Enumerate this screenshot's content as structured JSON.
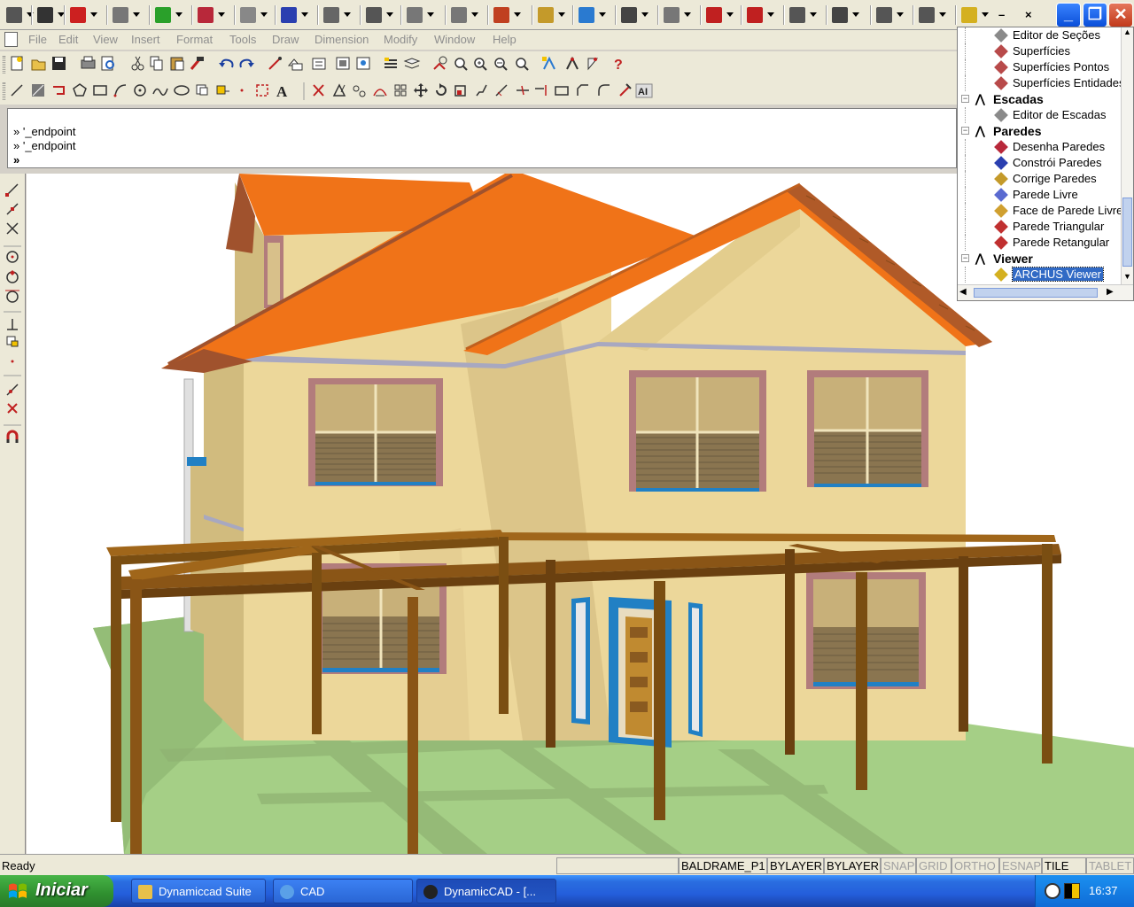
{
  "menu": [
    "File",
    "Edit",
    "View",
    "Insert",
    "Format",
    "Tools",
    "Draw",
    "Dimension",
    "Modify",
    "Window",
    "Help"
  ],
  "command": {
    "history": [
      "» '_endpoint",
      "» '_endpoint"
    ],
    "prompt": "»"
  },
  "tree": {
    "rows": [
      {
        "type": "item",
        "label": "Editor de Seções",
        "icon": "section-editor-icon",
        "color": "#8a8a8a"
      },
      {
        "type": "item",
        "label": "Superfícies",
        "icon": "surface-icon",
        "color": "#b84a4a"
      },
      {
        "type": "item",
        "label": "Superfícies Pontos",
        "icon": "surface-points-icon",
        "color": "#b84a4a"
      },
      {
        "type": "item",
        "label": "Superfícies Entidades",
        "icon": "surface-entities-icon",
        "color": "#b84a4a"
      },
      {
        "type": "category",
        "label": "Escadas"
      },
      {
        "type": "item",
        "label": "Editor de Escadas",
        "icon": "stairs-editor-icon",
        "color": "#8a8a8a"
      },
      {
        "type": "category",
        "label": "Paredes"
      },
      {
        "type": "item",
        "label": "Desenha Paredes",
        "icon": "draw-walls-icon",
        "color": "#b8283a"
      },
      {
        "type": "item",
        "label": "Constrói Paredes",
        "icon": "build-walls-icon",
        "color": "#2a3fb0"
      },
      {
        "type": "item",
        "label": "Corrige Paredes",
        "icon": "fix-walls-icon",
        "color": "#c49a2a"
      },
      {
        "type": "item",
        "label": "Parede Livre",
        "icon": "free-wall-icon",
        "color": "#5a6ad0"
      },
      {
        "type": "item",
        "label": "Face de Parede Livre",
        "icon": "free-wall-face-icon",
        "color": "#d0a030"
      },
      {
        "type": "item",
        "label": "Parede Triangular",
        "icon": "triangular-wall-icon",
        "color": "#c03030"
      },
      {
        "type": "item",
        "label": "Parede Retangular",
        "icon": "rectangular-wall-icon",
        "color": "#c03030"
      },
      {
        "type": "category",
        "label": "Viewer"
      },
      {
        "type": "item",
        "label": "ARCHUS Viewer",
        "icon": "archus-viewer-icon",
        "color": "#d4b020",
        "selected": true
      }
    ]
  },
  "status": {
    "ready": "Ready",
    "cells": [
      {
        "label": "",
        "active": true
      },
      {
        "label": "BALDRAME_P1",
        "active": true
      },
      {
        "label": "BYLAYER",
        "active": true
      },
      {
        "label": "BYLAYER",
        "active": true
      },
      {
        "label": "SNAP",
        "active": false
      },
      {
        "label": "GRID",
        "active": false
      },
      {
        "label": "ORTHO",
        "active": false
      },
      {
        "label": "ESNAP",
        "active": false
      },
      {
        "label": "TILE",
        "active": true
      },
      {
        "label": "TABLET",
        "active": false
      }
    ]
  },
  "taskbar": {
    "start": "Iniciar",
    "tasks": [
      {
        "label": "Dynamiccad Suite",
        "icon": "folder-icon",
        "active": false
      },
      {
        "label": "CAD",
        "icon": "ie-icon",
        "active": false
      },
      {
        "label": "DynamicCAD - [...",
        "icon": "dynamiccad-icon",
        "active": true
      }
    ],
    "clock": "16:37"
  },
  "colors": {
    "wall": "#ecd79a",
    "wall_shade": "#d1bb7e",
    "roof": "#f07318",
    "roof_trim": "#a0522d",
    "window_frame": "#b27c7c",
    "pergola": "#7a4e12",
    "ground": "#a5cf86",
    "door_blue": "#2180c4"
  }
}
